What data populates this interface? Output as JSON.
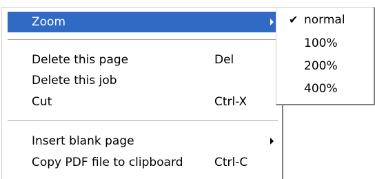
{
  "menu": {
    "items": [
      {
        "label": "Zoom",
        "shortcut": "",
        "submenu": true,
        "highlighted": true
      },
      {
        "label": "Delete this page",
        "shortcut": "Del"
      },
      {
        "label": "Delete this job",
        "shortcut": ""
      },
      {
        "label": "Cut",
        "shortcut": "Ctrl-X"
      },
      {
        "label": "Insert blank page",
        "shortcut": "",
        "submenu": true
      },
      {
        "label": "Copy PDF file to clipboard",
        "shortcut": "Ctrl-C"
      }
    ]
  },
  "zoom_submenu": {
    "items": [
      {
        "label": "normal",
        "checked": true,
        "check_glyph": "✔"
      },
      {
        "label": "100%"
      },
      {
        "label": "200%"
      },
      {
        "label": "400%"
      }
    ]
  },
  "colors": {
    "highlight": "#316ac5",
    "highlight_text": "#ffffff",
    "menu_bg": "#ffffff"
  }
}
